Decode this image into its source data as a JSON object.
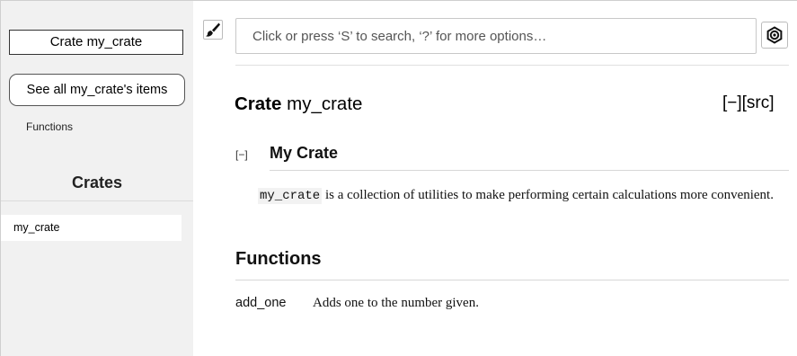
{
  "sidebar": {
    "crate_title": "Crate my_crate",
    "see_all_label": "See all my_crate's items",
    "functions_link": "Functions",
    "crates_heading": "Crates",
    "crate_items": [
      "my_crate"
    ]
  },
  "search": {
    "placeholder": "Click or press ‘S’ to search, ‘?’ for more options…",
    "value": ""
  },
  "icons": {
    "theme": "paintbrush-icon",
    "settings": "gear-icon"
  },
  "main": {
    "title_kind": "Crate",
    "title_name": "my_crate",
    "toggle_label": "[−]",
    "src_label": "[src]",
    "section_toggle": "[−]",
    "doc_heading": "My Crate",
    "doc_code": "my_crate",
    "doc_text": " is a collection of utilities to make performing certain calculations more convenient.",
    "functions_heading": "Functions",
    "functions": [
      {
        "name": "add_one",
        "description": "Adds one to the number given."
      }
    ]
  }
}
